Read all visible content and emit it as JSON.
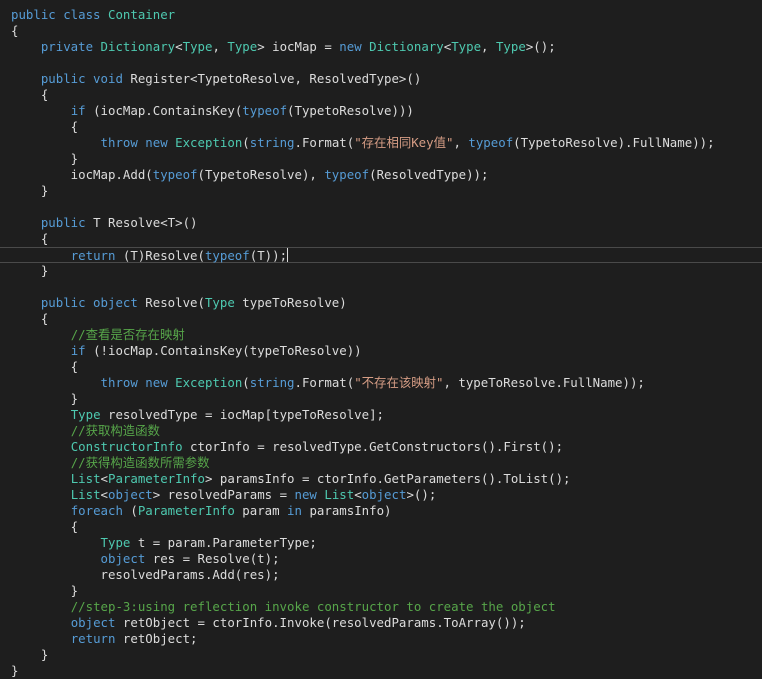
{
  "editor": {
    "colors": {
      "background": "#1e1e1e",
      "plain": "#dcdcdc",
      "keyword": "#569cd6",
      "type": "#4ec9b0",
      "string": "#d69d85",
      "comment": "#57a64a"
    },
    "current_line": 15,
    "lines": [
      [
        [
          "k",
          "public class "
        ],
        [
          "t",
          "Container"
        ]
      ],
      [
        [
          "p",
          "{"
        ]
      ],
      [
        [
          "p",
          "    "
        ],
        [
          "k",
          "private "
        ],
        [
          "t",
          "Dictionary"
        ],
        [
          "p",
          "<"
        ],
        [
          "t",
          "Type"
        ],
        [
          "p",
          ", "
        ],
        [
          "t",
          "Type"
        ],
        [
          "p",
          "> iocMap = "
        ],
        [
          "k",
          "new "
        ],
        [
          "t",
          "Dictionary"
        ],
        [
          "p",
          "<"
        ],
        [
          "t",
          "Type"
        ],
        [
          "p",
          ", "
        ],
        [
          "t",
          "Type"
        ],
        [
          "p",
          ">();"
        ]
      ],
      [],
      [
        [
          "p",
          "    "
        ],
        [
          "k",
          "public void "
        ],
        [
          "p",
          "Register<TypetoResolve, ResolvedType>()"
        ]
      ],
      [
        [
          "p",
          "    {"
        ]
      ],
      [
        [
          "p",
          "        "
        ],
        [
          "k",
          "if "
        ],
        [
          "p",
          "(iocMap.ContainsKey("
        ],
        [
          "k",
          "typeof"
        ],
        [
          "p",
          "(TypetoResolve)))"
        ]
      ],
      [
        [
          "p",
          "        {"
        ]
      ],
      [
        [
          "p",
          "            "
        ],
        [
          "k",
          "throw new "
        ],
        [
          "t",
          "Exception"
        ],
        [
          "p",
          "("
        ],
        [
          "k",
          "string"
        ],
        [
          "p",
          ".Format("
        ],
        [
          "s",
          "\"存在相同Key值\""
        ],
        [
          "p",
          ", "
        ],
        [
          "k",
          "typeof"
        ],
        [
          "p",
          "(TypetoResolve).FullName));"
        ]
      ],
      [
        [
          "p",
          "        }"
        ]
      ],
      [
        [
          "p",
          "        iocMap.Add("
        ],
        [
          "k",
          "typeof"
        ],
        [
          "p",
          "(TypetoResolve), "
        ],
        [
          "k",
          "typeof"
        ],
        [
          "p",
          "(ResolvedType));"
        ]
      ],
      [
        [
          "p",
          "    }"
        ]
      ],
      [],
      [
        [
          "p",
          "    "
        ],
        [
          "k",
          "public "
        ],
        [
          "p",
          "T Resolve<T>()"
        ]
      ],
      [
        [
          "p",
          "    {"
        ]
      ],
      [
        [
          "p",
          "        "
        ],
        [
          "k",
          "return "
        ],
        [
          "p",
          "(T)Resolve("
        ],
        [
          "k",
          "typeof"
        ],
        [
          "p",
          "(T));"
        ]
      ],
      [
        [
          "p",
          "    }"
        ]
      ],
      [],
      [
        [
          "p",
          "    "
        ],
        [
          "k",
          "public object "
        ],
        [
          "p",
          "Resolve("
        ],
        [
          "t",
          "Type"
        ],
        [
          "p",
          " typeToResolve)"
        ]
      ],
      [
        [
          "p",
          "    {"
        ]
      ],
      [
        [
          "p",
          "        "
        ],
        [
          "c",
          "//查看是否存在映射"
        ]
      ],
      [
        [
          "p",
          "        "
        ],
        [
          "k",
          "if "
        ],
        [
          "p",
          "(!iocMap.ContainsKey(typeToResolve))"
        ]
      ],
      [
        [
          "p",
          "        {"
        ]
      ],
      [
        [
          "p",
          "            "
        ],
        [
          "k",
          "throw new "
        ],
        [
          "t",
          "Exception"
        ],
        [
          "p",
          "("
        ],
        [
          "k",
          "string"
        ],
        [
          "p",
          ".Format("
        ],
        [
          "s",
          "\"不存在该映射\""
        ],
        [
          "p",
          ", typeToResolve.FullName));"
        ]
      ],
      [
        [
          "p",
          "        }"
        ]
      ],
      [
        [
          "p",
          "        "
        ],
        [
          "t",
          "Type"
        ],
        [
          "p",
          " resolvedType = iocMap[typeToResolve];"
        ]
      ],
      [
        [
          "p",
          "        "
        ],
        [
          "c",
          "//获取构造函数"
        ]
      ],
      [
        [
          "p",
          "        "
        ],
        [
          "t",
          "ConstructorInfo"
        ],
        [
          "p",
          " ctorInfo = resolvedType.GetConstructors().First();"
        ]
      ],
      [
        [
          "p",
          "        "
        ],
        [
          "c",
          "//获得构造函数所需参数"
        ]
      ],
      [
        [
          "p",
          "        "
        ],
        [
          "t",
          "List"
        ],
        [
          "p",
          "<"
        ],
        [
          "t",
          "ParameterInfo"
        ],
        [
          "p",
          "> paramsInfo = ctorInfo.GetParameters().ToList();"
        ]
      ],
      [
        [
          "p",
          "        "
        ],
        [
          "t",
          "List"
        ],
        [
          "p",
          "<"
        ],
        [
          "k",
          "object"
        ],
        [
          "p",
          "> resolvedParams = "
        ],
        [
          "k",
          "new "
        ],
        [
          "t",
          "List"
        ],
        [
          "p",
          "<"
        ],
        [
          "k",
          "object"
        ],
        [
          "p",
          ">();"
        ]
      ],
      [
        [
          "p",
          "        "
        ],
        [
          "k",
          "foreach "
        ],
        [
          "p",
          "("
        ],
        [
          "t",
          "ParameterInfo"
        ],
        [
          "p",
          " param "
        ],
        [
          "k",
          "in "
        ],
        [
          "p",
          "paramsInfo)"
        ]
      ],
      [
        [
          "p",
          "        {"
        ]
      ],
      [
        [
          "p",
          "            "
        ],
        [
          "t",
          "Type"
        ],
        [
          "p",
          " t = param.ParameterType;"
        ]
      ],
      [
        [
          "p",
          "            "
        ],
        [
          "k",
          "object "
        ],
        [
          "p",
          "res = Resolve(t);"
        ]
      ],
      [
        [
          "p",
          "            resolvedParams.Add(res);"
        ]
      ],
      [
        [
          "p",
          "        }"
        ]
      ],
      [
        [
          "p",
          "        "
        ],
        [
          "c",
          "//step-3:using reflection invoke constructor to create the object"
        ]
      ],
      [
        [
          "p",
          "        "
        ],
        [
          "k",
          "object "
        ],
        [
          "p",
          "retObject = ctorInfo.Invoke(resolvedParams.ToArray());"
        ]
      ],
      [
        [
          "p",
          "        "
        ],
        [
          "k",
          "return "
        ],
        [
          "p",
          "retObject;"
        ]
      ],
      [
        [
          "p",
          "    }"
        ]
      ],
      [
        [
          "p",
          "}"
        ]
      ]
    ]
  }
}
